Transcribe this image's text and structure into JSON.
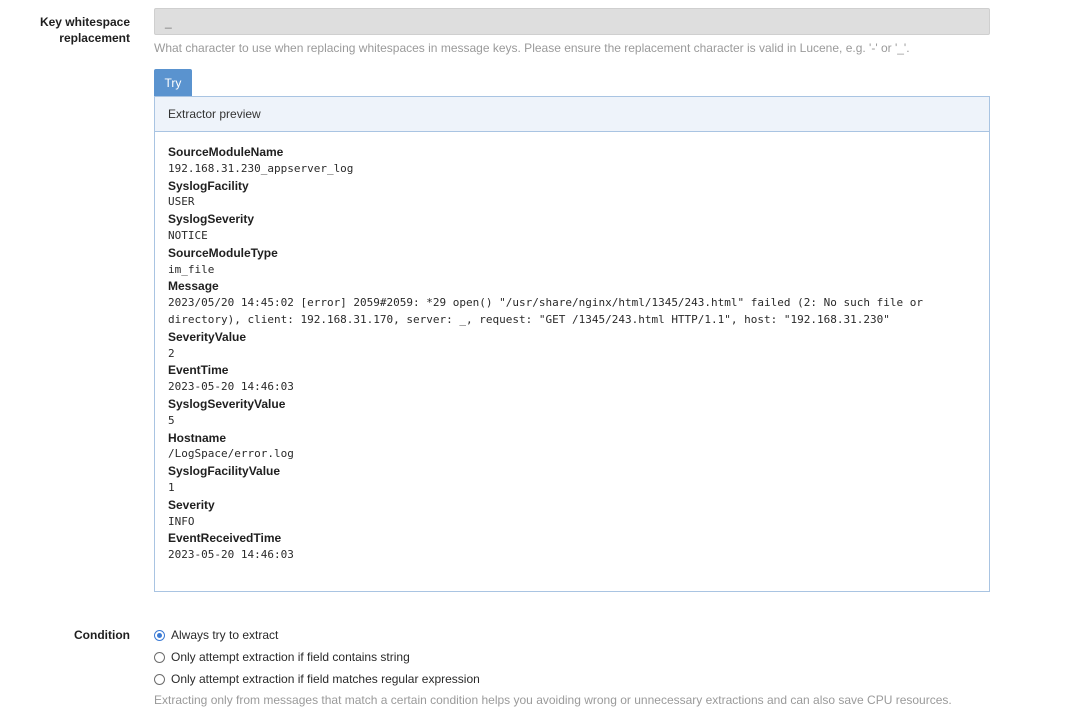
{
  "whitespace": {
    "label": "Key whitespace replacement",
    "value": "_",
    "help": "What character to use when replacing whitespaces in message keys. Please ensure the replacement character is valid in Lucene, e.g. '-' or '_'."
  },
  "try_button": "Try",
  "preview": {
    "title": "Extractor preview",
    "fields": [
      {
        "name": "SourceModuleName",
        "value": "192.168.31.230_appserver_log"
      },
      {
        "name": "SyslogFacility",
        "value": "USER"
      },
      {
        "name": "SyslogSeverity",
        "value": "NOTICE"
      },
      {
        "name": "SourceModuleType",
        "value": "im_file"
      },
      {
        "name": "Message",
        "value": "2023/05/20 14:45:02 [error] 2059#2059: *29 open() \"/usr/share/nginx/html/1345/243.html\" failed (2: No such file or directory), client: 192.168.31.170, server: _, request: \"GET /1345/243.html HTTP/1.1\", host: \"192.168.31.230\""
      },
      {
        "name": "SeverityValue",
        "value": "2"
      },
      {
        "name": "EventTime",
        "value": "2023-05-20 14:46:03"
      },
      {
        "name": "SyslogSeverityValue",
        "value": "5"
      },
      {
        "name": "Hostname",
        "value": "/LogSpace/error.log"
      },
      {
        "name": "SyslogFacilityValue",
        "value": "1"
      },
      {
        "name": "Severity",
        "value": "INFO"
      },
      {
        "name": "EventReceivedTime",
        "value": "2023-05-20 14:46:03"
      }
    ]
  },
  "condition": {
    "label": "Condition",
    "options": [
      {
        "label": "Always try to extract",
        "checked": true
      },
      {
        "label": "Only attempt extraction if field contains string",
        "checked": false
      },
      {
        "label": "Only attempt extraction if field matches regular expression",
        "checked": false
      }
    ],
    "help": "Extracting only from messages that match a certain condition helps you avoiding wrong or unnecessary extractions and can also save CPU resources."
  }
}
